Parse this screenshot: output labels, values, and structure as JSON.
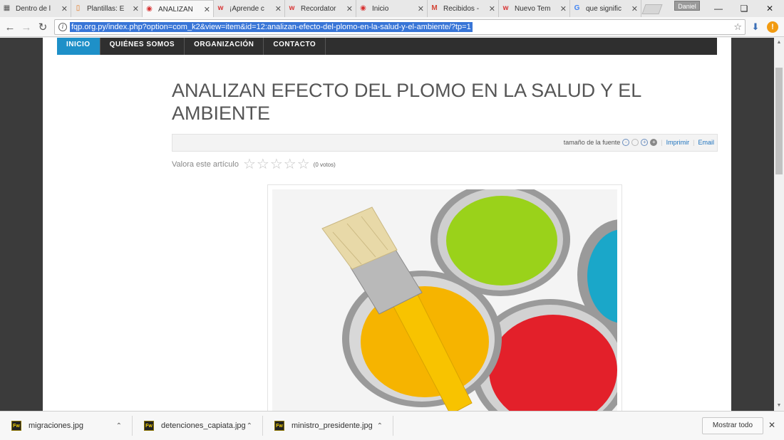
{
  "tabs": [
    {
      "title": "Dentro de l",
      "icon": "page-icon",
      "color": "#555555"
    },
    {
      "title": "Plantillas: E",
      "icon": "puzzle-icon",
      "color": "#e2731a"
    },
    {
      "title": "ANALIZAN",
      "icon": "drop-icon",
      "color": "#d83333",
      "active": true
    },
    {
      "title": "¡Aprende c",
      "icon": "w-icon",
      "color": "#d83333"
    },
    {
      "title": "Recordator",
      "icon": "w-icon",
      "color": "#d83333"
    },
    {
      "title": "Inicio",
      "icon": "drop-icon",
      "color": "#d83333"
    },
    {
      "title": "Recibidos -",
      "icon": "m-icon",
      "color": "#d44638"
    },
    {
      "title": "Nuevo Tem",
      "icon": "w-icon",
      "color": "#d83333"
    },
    {
      "title": "que signific",
      "icon": "g-icon",
      "color": "#4285f4"
    }
  ],
  "profile_name": "Daniel",
  "url": "fqp.org.py/index.php?option=com_k2&view=item&id=12:analizan-efecto-del-plomo-en-la-salud-y-el-ambiente/?tp=1",
  "nav": {
    "items": [
      "INICIO",
      "QUIÉNES SOMOS",
      "ORGANIZACIÓN",
      "CONTACTO"
    ]
  },
  "article": {
    "title": "ANALIZAN EFECTO DEL PLOMO EN LA SALUD Y EL AMBIENTE",
    "font_size_label": "tamaño de la fuente",
    "print_label": "Imprimir",
    "email_label": "Email",
    "rate_label": "Valora este artículo",
    "votes": "(0 votos)",
    "stars": 5
  },
  "downloads": [
    {
      "name": "migraciones.jpg"
    },
    {
      "name": "detenciones_capiata.jpg"
    },
    {
      "name": "ministro_presidente.jpg"
    }
  ],
  "show_all_label": "Mostrar todo",
  "colors": {
    "accent_nav": "#1e90c8",
    "nav_bar": "#2f2f2f",
    "paint_yellow": "#f6b400",
    "paint_green": "#9ad21a",
    "paint_red": "#e3202a",
    "paint_blue": "#1aa7c9"
  }
}
